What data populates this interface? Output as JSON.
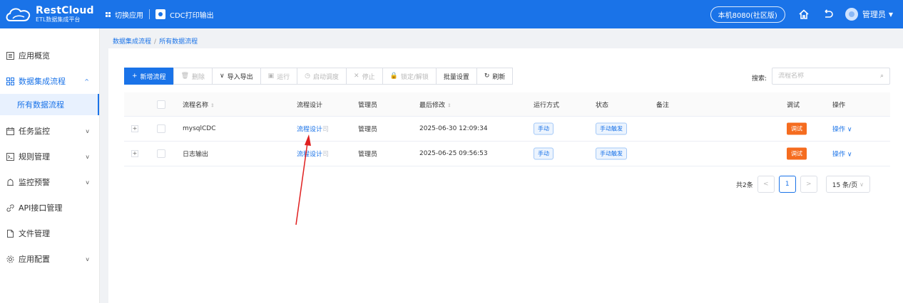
{
  "brand": {
    "name": "RestCloud",
    "sub": "ETL数据集成平台"
  },
  "topbar": {
    "switch_app": "切换应用",
    "current_app": "CDC打印输出",
    "env": "本机8080(社区版)",
    "user": "管理员"
  },
  "sidebar": {
    "items": [
      {
        "label": "应用概览",
        "icon": "overview-icon"
      },
      {
        "label": "数据集成流程",
        "icon": "grid-icon"
      },
      {
        "label": "所有数据流程"
      },
      {
        "label": "任务监控",
        "icon": "calendar-icon"
      },
      {
        "label": "规则管理",
        "icon": "terminal-icon"
      },
      {
        "label": "监控预警",
        "icon": "alert-icon"
      },
      {
        "label": "API接口管理",
        "icon": "link-icon"
      },
      {
        "label": "文件管理",
        "icon": "file-icon"
      },
      {
        "label": "应用配置",
        "icon": "settings-icon"
      }
    ]
  },
  "breadcrumb": {
    "parent": "数据集成流程",
    "separator": "/",
    "current": "所有数据流程"
  },
  "toolbar": {
    "new_flow": "新增流程",
    "delete": "删除",
    "import_export": "导入导出",
    "run": "运行",
    "start_schedule": "启动调度",
    "stop": "停止",
    "lock_unlock": "锁定/解锁",
    "batch_settings": "批量设置",
    "refresh": "刷新"
  },
  "search": {
    "label": "搜索:",
    "placeholder": "流程名称"
  },
  "table": {
    "headers": {
      "name": "流程名称",
      "design": "流程设计",
      "admin": "管理员",
      "modified": "最后修改",
      "run_mode": "运行方式",
      "status": "状态",
      "remark": "备注",
      "debug": "调试",
      "action": "操作"
    },
    "rows": [
      {
        "name": "mysqlCDC",
        "design": "流程设计",
        "design_extra": "司",
        "admin": "管理员",
        "modified": "2025-06-30 12:09:34",
        "run_mode": "手动",
        "status": "手动触发",
        "remark": "",
        "debug": "调试",
        "action": "操作"
      },
      {
        "name": "日志输出",
        "design": "流程设计",
        "design_extra": "司",
        "admin": "管理员",
        "modified": "2025-06-25 09:56:53",
        "run_mode": "手动",
        "status": "手动触发",
        "remark": "",
        "debug": "调试",
        "action": "操作"
      }
    ]
  },
  "pagination": {
    "total": "共2条",
    "current_page": "1",
    "page_size": "15 条/页"
  },
  "colors": {
    "primary": "#1a73e8",
    "debug": "#f56c1f",
    "annotation_arrow": "#e02020"
  }
}
